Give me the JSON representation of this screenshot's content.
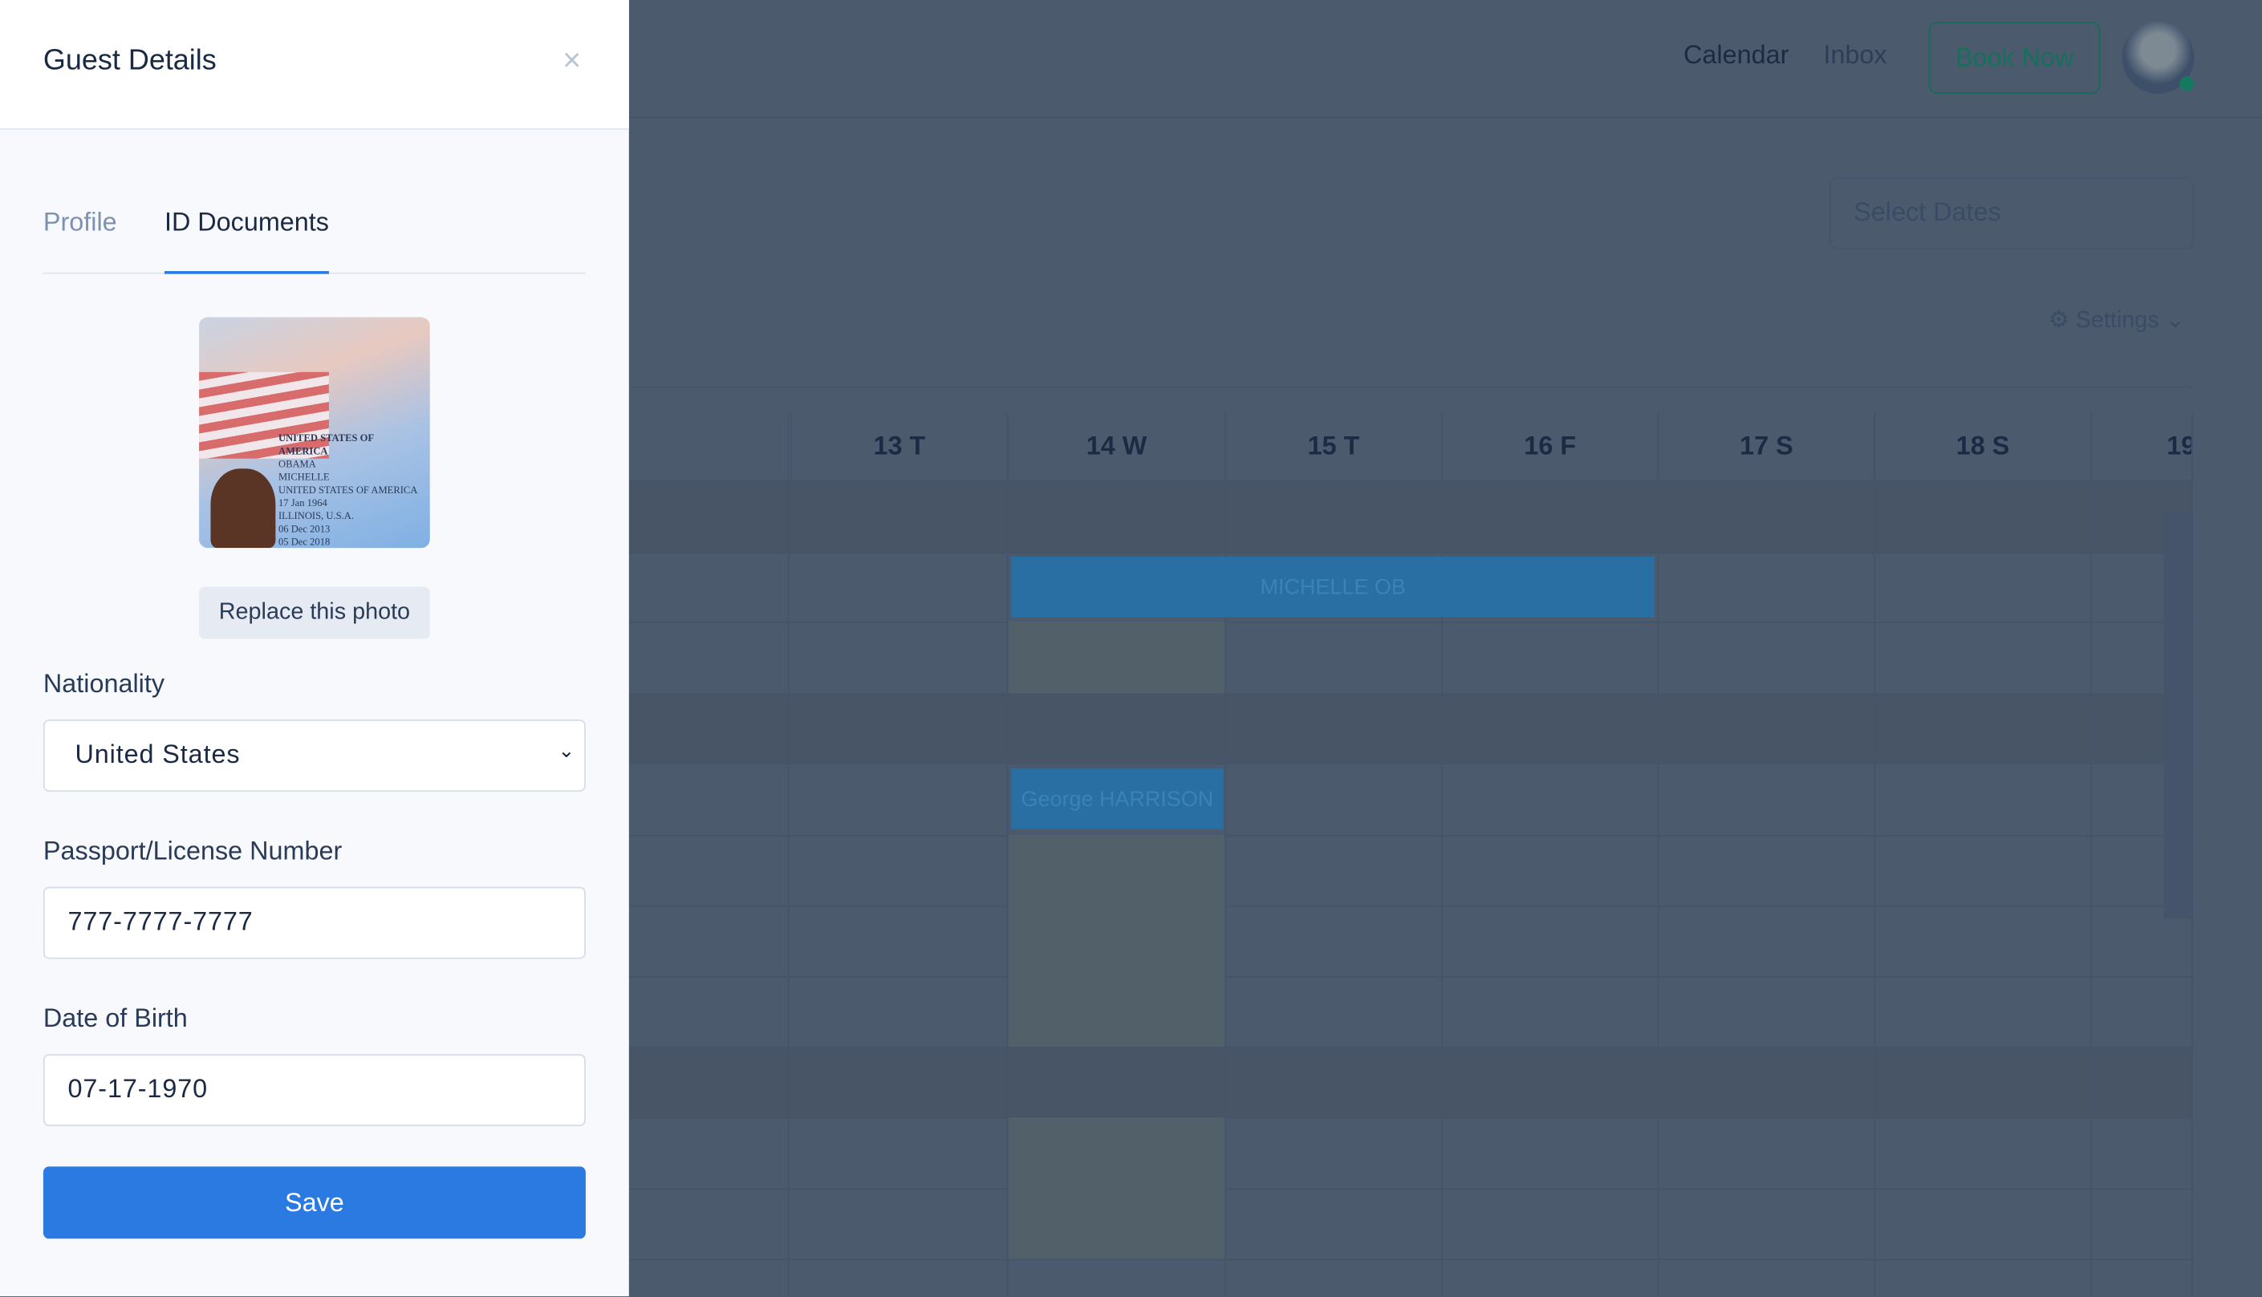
{
  "header": {
    "nav": [
      "Calendar",
      "Inbox"
    ],
    "book_now": "Book Now"
  },
  "toolbar": {
    "date_placeholder": "Select Dates",
    "settings": "Settings"
  },
  "calendar": {
    "days": [
      "13 T",
      "14 W",
      "15 T",
      "16 F",
      "17 S",
      "18 S",
      "19"
    ],
    "bookings": [
      {
        "guest": "MICHELLE OB"
      },
      {
        "guest": "George HARRISON"
      }
    ]
  },
  "panel": {
    "title": "Guest Details",
    "close": "×",
    "tabs": [
      "Profile",
      "ID Documents"
    ],
    "active_tab": "ID Documents",
    "photo_text": [
      "UNITED STATES OF AMERICA",
      "OBAMA",
      "MICHELLE",
      "UNITED STATES OF AMERICA",
      "17 Jan 1964",
      "ILLINOIS, U.S.A.",
      "06 Dec 2013",
      "05 Dec 2018"
    ],
    "replace_photo": "Replace this photo",
    "nationality_label": "Nationality",
    "nationality": "United States",
    "passport_label": "Passport/License Number",
    "passport": "777-7777-7777",
    "dob_label": "Date of Birth",
    "dob": "07-17-1970",
    "save": "Save"
  },
  "colors": {
    "accent": "#2a7ae2",
    "book_now": "#16705d",
    "booking": "#2a6fa3"
  }
}
